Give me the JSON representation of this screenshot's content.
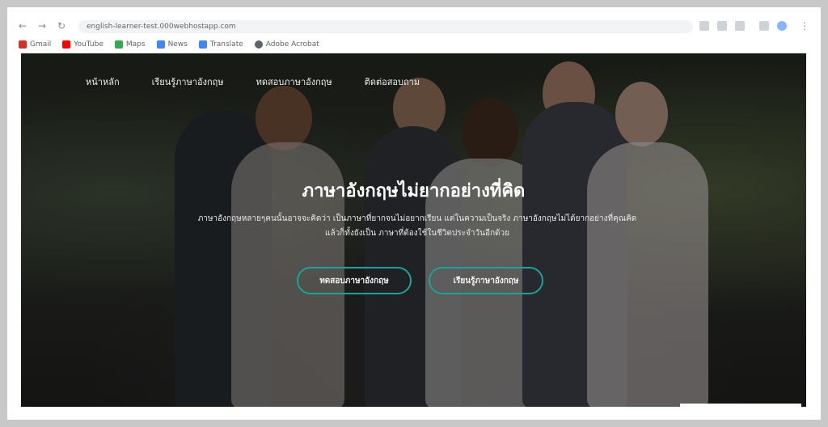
{
  "browser": {
    "url": "english-learner-test.000webhostapp.com",
    "bookmarks": [
      {
        "label": "Gmail",
        "color": "#d93025"
      },
      {
        "label": "YouTube",
        "color": "#ff0000"
      },
      {
        "label": "Maps",
        "color": "#34a853"
      },
      {
        "label": "News",
        "color": "#4285f4"
      },
      {
        "label": "Translate",
        "color": "#4285f4"
      },
      {
        "label": "Adobe Acrobat",
        "color": "#5f6368"
      }
    ]
  },
  "nav": {
    "items": [
      "หน้าหลัก",
      "เรียนรู้ภาษาอังกฤษ",
      "ทดสอบภาษาอังกฤษ",
      "ติดต่อสอบถาม"
    ]
  },
  "hero": {
    "title": "ภาษาอังกฤษไม่ยากอย่างที่คิด",
    "subtitle_line1": "ภาษาอังกฤษหลายๆคนนั้นอาจจะคิดว่า เป็นภาษาที่ยากจนไม่อยากเรียน แต่ในความเป็นจริง ภาษาอังกฤษไม่ได้ยากอย่างที่คุณคิด",
    "subtitle_line2": "แล้วก็ทั้งยังเป็น ภาษาที่ต้องใช้ในชีวิตประจำวันอีกด้วย",
    "button_test": "ทดสอบภาษาอังกฤษ",
    "button_learn": "เรียนรู้ภาษาอังกฤษ"
  },
  "colors": {
    "accent": "#1aa39a"
  }
}
